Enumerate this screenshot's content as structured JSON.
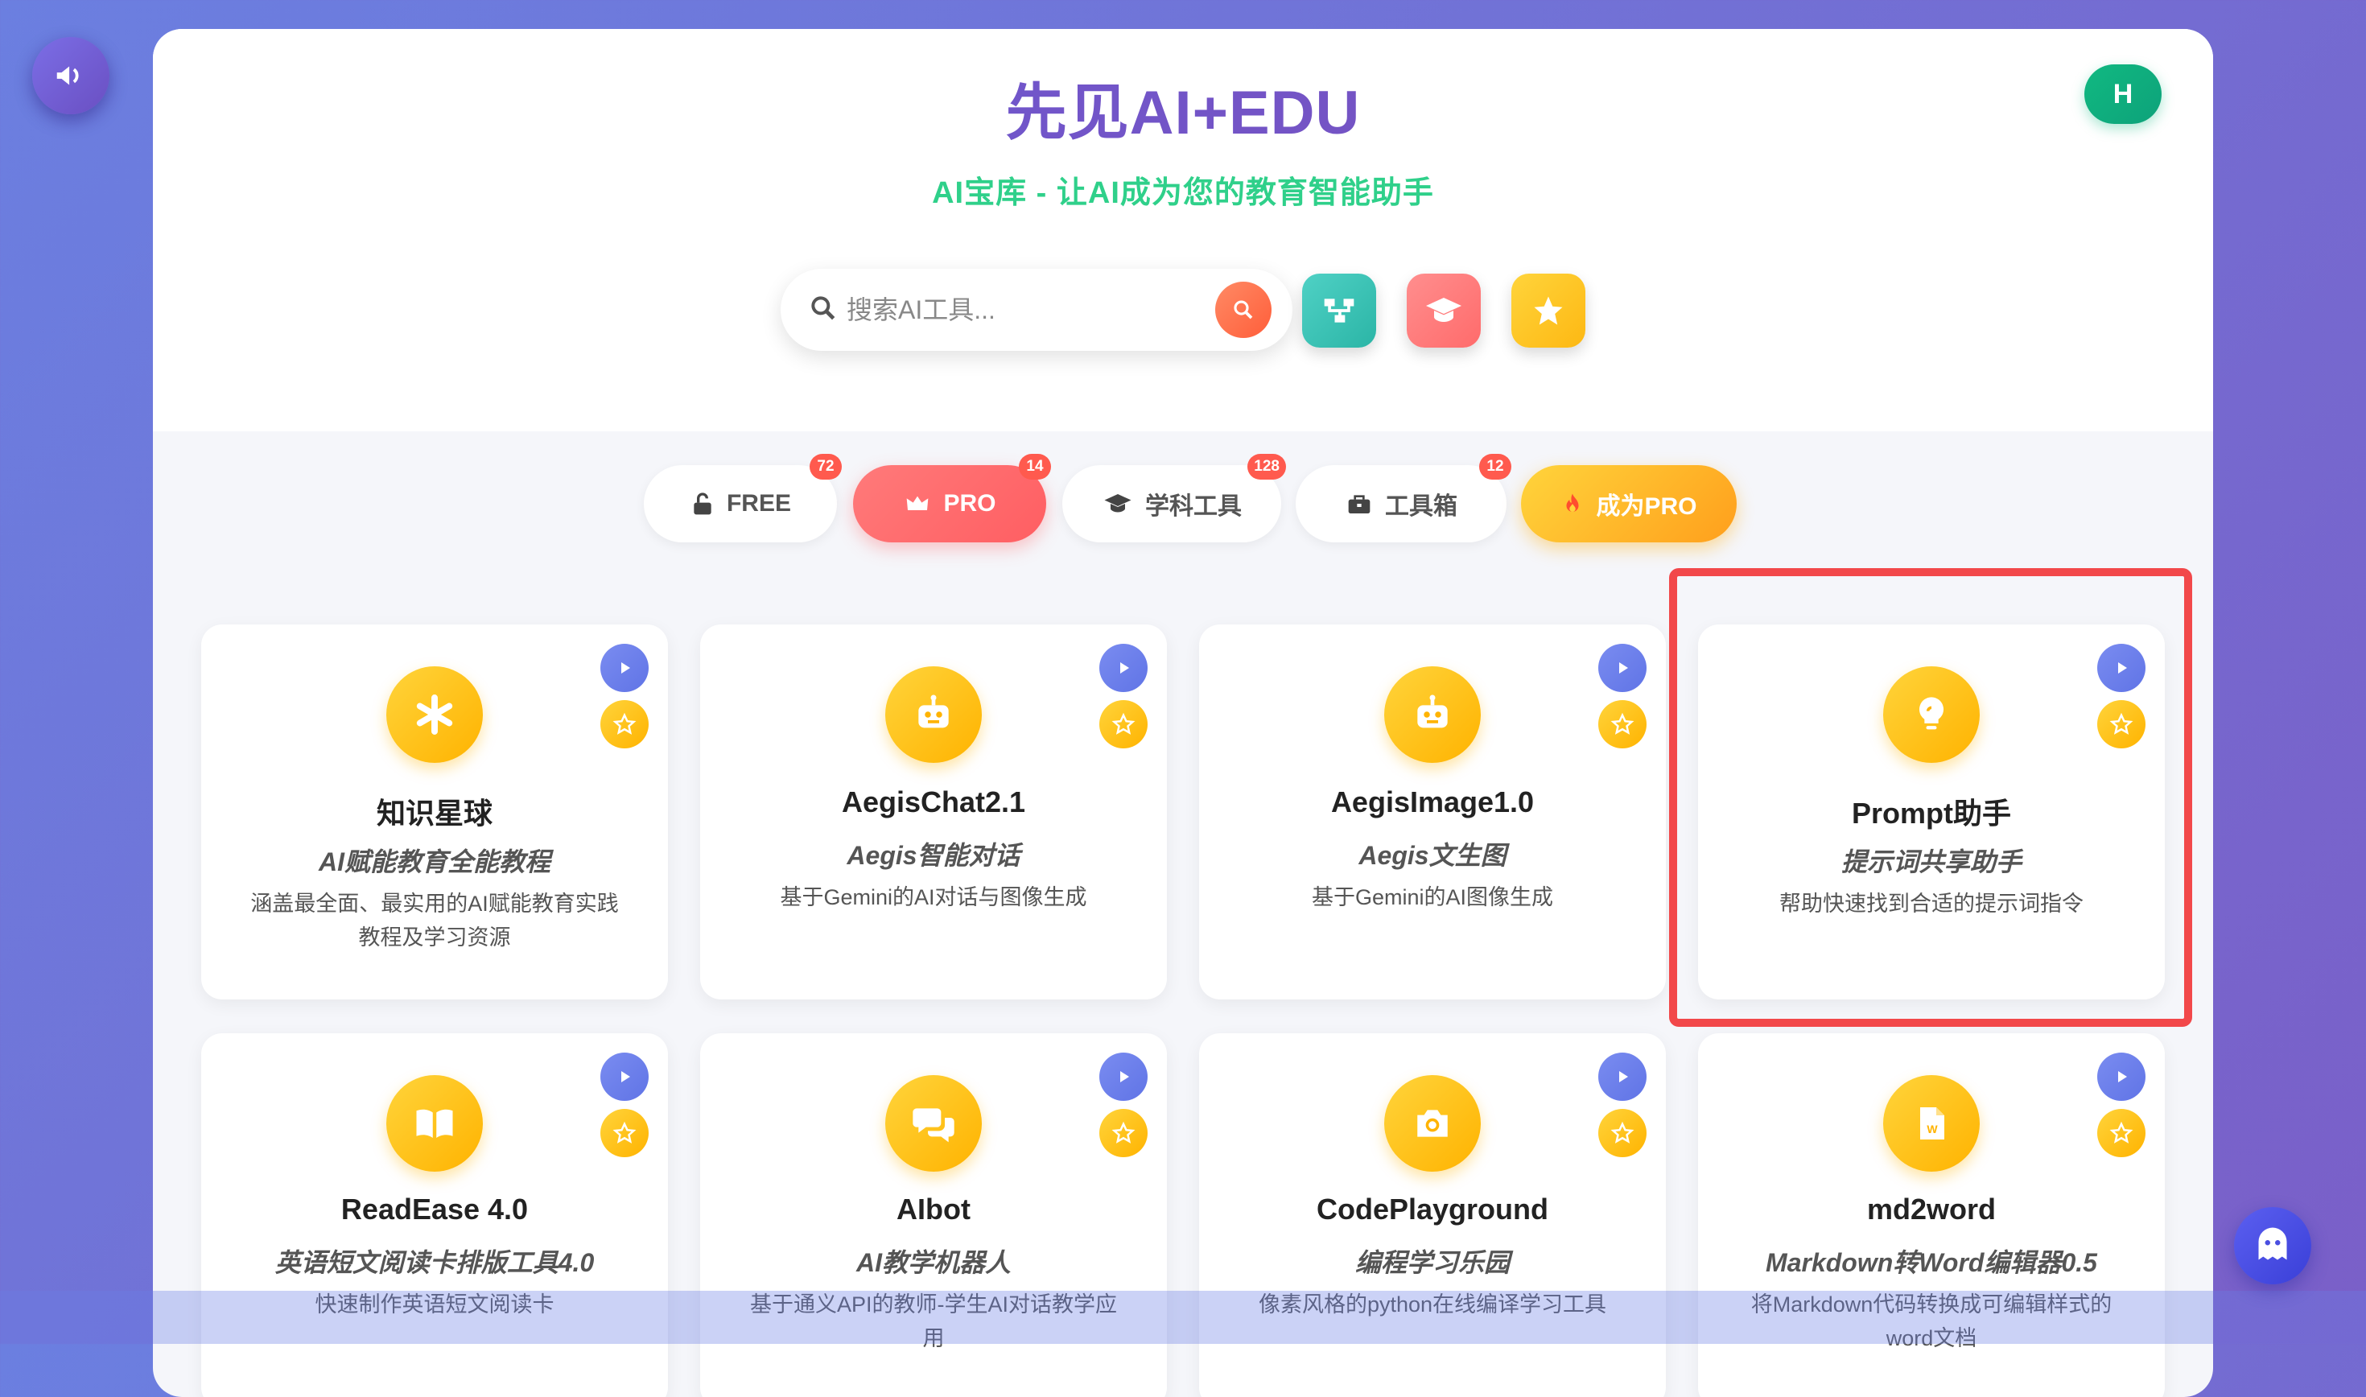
{
  "header": {
    "title": "先见AI+EDU",
    "subtitle": "AI宝库 - 让AI成为您的教育智能助手",
    "avatar_letter": "H"
  },
  "search": {
    "placeholder": "搜索AI工具..."
  },
  "quick_buttons": [
    "workflow-icon",
    "graduation-cap-icon",
    "star-icon"
  ],
  "tabs": [
    {
      "label": "FREE",
      "icon": "unlock-icon",
      "badge": "72"
    },
    {
      "label": "PRO",
      "icon": "crown-icon",
      "badge": "14"
    },
    {
      "label": "学科工具",
      "icon": "graduation-cap-icon",
      "badge": "128"
    },
    {
      "label": "工具箱",
      "icon": "toolbox-icon",
      "badge": "12"
    },
    {
      "label": "成为PRO",
      "icon": "fire-icon"
    }
  ],
  "cards": [
    {
      "name": "知识星球",
      "tag": "AI赋能教育全能教程",
      "desc": "涵盖最全面、最实用的AI赋能教育实践教程及学习资源",
      "icon": "asterisk-icon"
    },
    {
      "name": "AegisChat2.1",
      "tag": "Aegis智能对话",
      "desc": "基于Gemini的AI对话与图像生成",
      "icon": "robot-icon"
    },
    {
      "name": "AegisImage1.0",
      "tag": "Aegis文生图",
      "desc": "基于Gemini的AI图像生成",
      "icon": "robot-icon"
    },
    {
      "name": "Prompt助手",
      "tag": "提示词共享助手",
      "desc": "帮助快速找到合适的提示词指令",
      "icon": "lightbulb-icon"
    },
    {
      "name": "ReadEase 4.0",
      "tag": "英语短文阅读卡排版工具4.0",
      "desc": "快速制作英语短文阅读卡",
      "icon": "book-icon"
    },
    {
      "name": "AIbot",
      "tag": "AI教学机器人",
      "desc": "基于通义API的教师-学生AI对话教学应用",
      "icon": "chat-bubbles-icon"
    },
    {
      "name": "CodePlayground",
      "tag": "编程学习乐园",
      "desc": "像素风格的python在线编译学习工具",
      "icon": "camera-icon"
    },
    {
      "name": "md2word",
      "tag": "Markdown转Word编辑器0.5",
      "desc": "将Markdown代码转换成可编辑样式的word文档",
      "icon": "word-file-icon"
    }
  ],
  "colors": {
    "accent": "#6a5ad6",
    "pro": "#ff5e62",
    "gold": "#ffb300",
    "highlight": "#f2484a"
  }
}
